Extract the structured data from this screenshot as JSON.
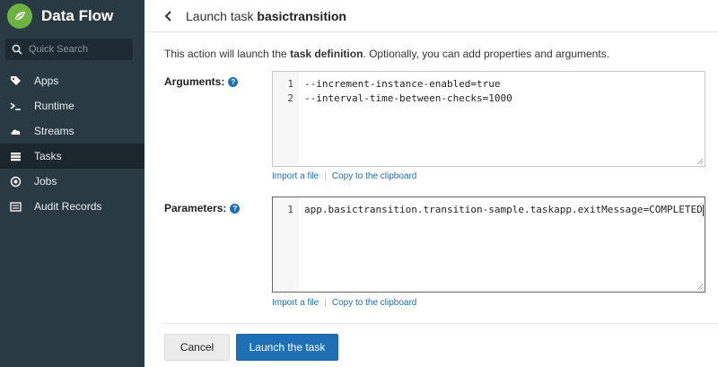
{
  "sidebar": {
    "brand": "Data Flow",
    "search_placeholder": "Quick Search",
    "items": [
      {
        "label": "Apps",
        "icon": "tag-icon"
      },
      {
        "label": "Runtime",
        "icon": "terminal-icon"
      },
      {
        "label": "Streams",
        "icon": "cloud-icon"
      },
      {
        "label": "Tasks",
        "icon": "server-icon",
        "active": true
      },
      {
        "label": "Jobs",
        "icon": "record-icon"
      },
      {
        "label": "Audit Records",
        "icon": "list-icon"
      }
    ]
  },
  "header": {
    "prefix": "Launch task",
    "task_name": "basictransition"
  },
  "intro": {
    "before": "This action will launch the ",
    "bold": "task definition",
    "after": ". Optionally, you can add properties and arguments."
  },
  "arguments": {
    "label": "Arguments:",
    "lines": [
      {
        "num": "1",
        "text": "--increment-instance-enabled=true"
      },
      {
        "num": "2",
        "text": "--interval-time-between-checks=1000"
      }
    ],
    "import_label": "Import a file",
    "copy_label": "Copy to the clipboard"
  },
  "parameters": {
    "label": "Parameters:",
    "lines": [
      {
        "num": "1",
        "text": "app.basictransition.transition-sample.taskapp.exitMessage=COMPLETED"
      }
    ],
    "import_label": "Import a file",
    "copy_label": "Copy to the clipboard"
  },
  "actions": {
    "cancel_label": "Cancel",
    "launch_label": "Launch the task"
  },
  "colors": {
    "sidebar_bg": "#2a3a43",
    "sidebar_active": "#1c272d",
    "brand_green": "#6db33f",
    "primary_blue": "#1f6fb5"
  }
}
